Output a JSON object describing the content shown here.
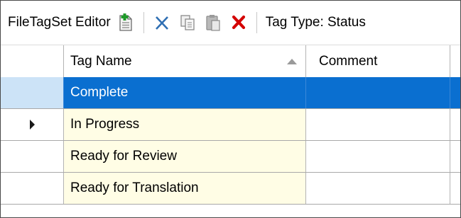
{
  "toolbar": {
    "title": "FileTagSet Editor",
    "tag_type": "Tag Type: Status",
    "buttons": [
      {
        "icon": "new-document-icon"
      },
      {
        "icon": "cut-icon"
      },
      {
        "icon": "copy-icon"
      },
      {
        "icon": "paste-icon"
      },
      {
        "icon": "delete-icon"
      }
    ]
  },
  "grid": {
    "columns": [
      "Tag Name",
      "Comment"
    ],
    "sort": {
      "column": "Tag Name",
      "direction": "ascending"
    },
    "rows": [
      {
        "tag_name": "Complete",
        "comment": "",
        "selected": true
      },
      {
        "tag_name": "In Progress",
        "comment": "",
        "current": true
      },
      {
        "tag_name": "Ready for Review",
        "comment": ""
      },
      {
        "tag_name": "Ready for Translation",
        "comment": ""
      }
    ]
  },
  "colors": {
    "selection": "#0a6fd0",
    "row_header_selected": "#cce3f7",
    "tag_name_cell": "#fffde5",
    "delete_icon": "#d40000",
    "new_icon_plus": "#1f9a2a"
  }
}
